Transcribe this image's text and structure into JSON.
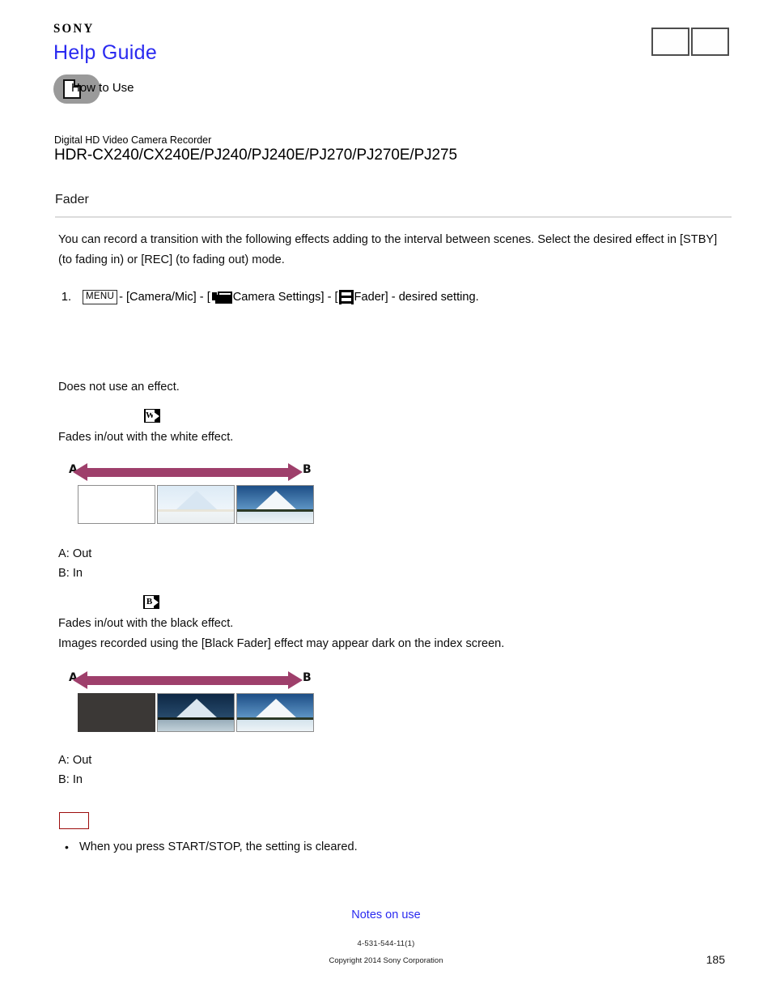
{
  "header": {
    "brand": "SONY",
    "title": "Help Guide",
    "tab_label": "How to Use",
    "boxes": [
      {
        "label": ""
      },
      {
        "label": ""
      }
    ]
  },
  "product": {
    "kicker": "Digital HD Video Camera Recorder",
    "model": "HDR-CX240/CX240E/PJ240/PJ240E/PJ270/PJ270E/PJ275"
  },
  "section": {
    "title": "Fader"
  },
  "intro": {
    "paragraph": "You can record a transition with the following effects adding to the interval between scenes. Select the desired effect in [STBY] (to fading in) or [REC] (to fading out) mode."
  },
  "step": {
    "number": "1.",
    "menu_label": "MENU",
    "sep1": " - [Camera/Mic] - [",
    "camera_settings_label": "Camera Settings] - [",
    "fader_label": "Fader] - desired setting.",
    "camera_icon": "camera-settings-icon",
    "film_icon": "fader-filmstrip-icon"
  },
  "effects": [
    {
      "key": "off",
      "badge": null,
      "description": "Does not use an effect."
    },
    {
      "key": "white-fader",
      "badge": {
        "letter": "W",
        "name": "white-fader-icon"
      },
      "description": "Fades in/out with the white effect.",
      "figure": {
        "label_a": "A",
        "label_b": "B",
        "caption_a": "A: Out",
        "caption_b": "B: In",
        "frames": [
          "white-blank-frame",
          "pale-mountain-frame",
          "vivid-mountain-frame"
        ]
      }
    },
    {
      "key": "black-fader",
      "badge": {
        "letter": "B",
        "name": "black-fader-icon"
      },
      "description": "Fades in/out with the black effect.",
      "description2": "Images recorded using the [Black Fader] effect may appear dark on the index screen.",
      "figure": {
        "label_a": "A",
        "label_b": "B",
        "caption_a": "A: Out",
        "caption_b": "B: In",
        "frames": [
          "black-blank-frame",
          "dark-mountain-frame",
          "vivid-mountain-frame"
        ]
      }
    }
  ],
  "note": {
    "heading_placeholder": "",
    "bullet_symbol": "•",
    "items": [
      "When you press START/STOP, the setting is cleared."
    ]
  },
  "footer": {
    "link_label": "Notes on use",
    "doc_code": "4-531-544-11(1)",
    "copyright": "Copyright 2014 Sony Corporation",
    "page_number": "185"
  },
  "colors": {
    "link_blue": "#2a2af0",
    "arrow_maroon": "#9e3f6b",
    "note_border_red": "#9d0d0d",
    "rule_gray": "#dcdcdc"
  }
}
